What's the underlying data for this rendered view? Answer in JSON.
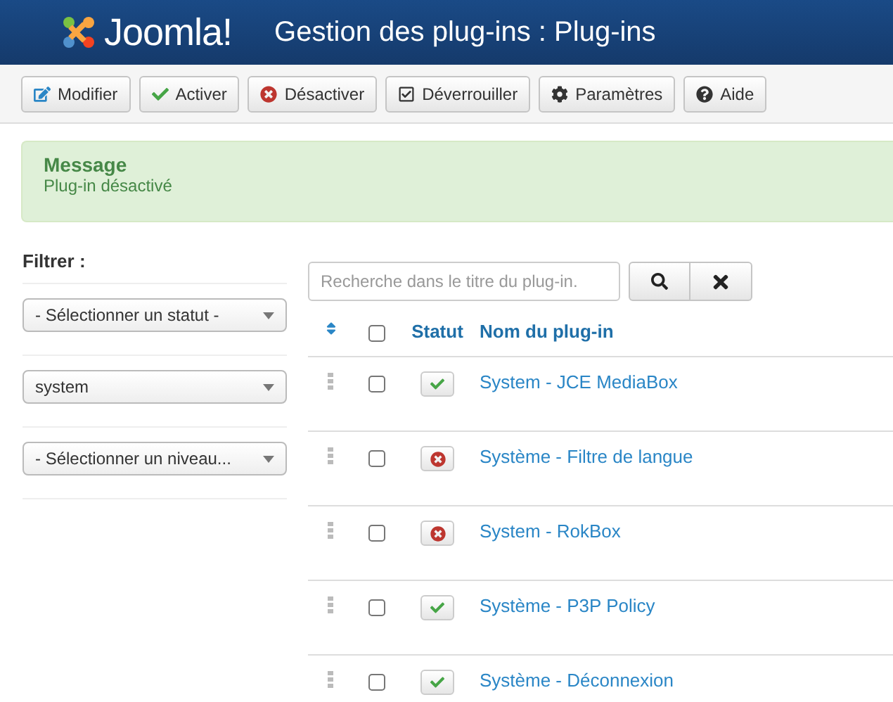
{
  "header": {
    "logo_text": "Joomla!",
    "title": "Gestion des plug-ins : Plug-ins"
  },
  "toolbar": [
    {
      "label": "Modifier"
    },
    {
      "label": "Activer"
    },
    {
      "label": "Désactiver"
    },
    {
      "label": "Déverrouiller"
    },
    {
      "label": "Paramètres"
    },
    {
      "label": "Aide"
    }
  ],
  "message": {
    "heading": "Message",
    "text": "Plug-in désactivé"
  },
  "filters": {
    "title": "Filtrer :",
    "selects": [
      {
        "value": "- Sélectionner un statut -"
      },
      {
        "value": "system"
      },
      {
        "value": "- Sélectionner un niveau..."
      }
    ]
  },
  "search": {
    "placeholder": "Recherche dans le titre du plug-in."
  },
  "table": {
    "header_checked": false,
    "columns": [
      "Statut",
      "Nom du plug-in"
    ],
    "rows": [
      {
        "name": "System - JCE MediaBox",
        "enabled": true,
        "checked": false
      },
      {
        "name": "Système - Filtre de langue",
        "enabled": false,
        "checked": false
      },
      {
        "name": "System - RokBox",
        "enabled": false,
        "checked": false
      },
      {
        "name": "Système - P3P Policy",
        "enabled": true,
        "checked": false
      },
      {
        "name": "Système - Déconnexion",
        "enabled": true,
        "checked": false
      }
    ]
  }
}
